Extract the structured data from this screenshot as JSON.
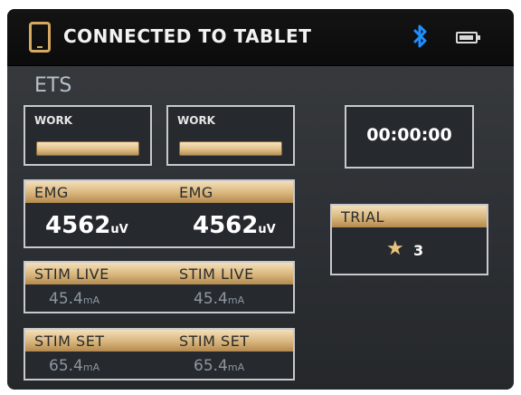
{
  "status_bar": {
    "connection_text": "CONNECTED TO TABLET",
    "icons": [
      "tablet-icon",
      "bluetooth-icon",
      "battery-icon"
    ]
  },
  "mode_title": "ETS",
  "work": [
    {
      "label": "WORK"
    },
    {
      "label": "WORK"
    }
  ],
  "timer": {
    "value": "00:00:00"
  },
  "emg": [
    {
      "label": "EMG",
      "value": "4562",
      "unit": "uV"
    },
    {
      "label": "EMG",
      "value": "4562",
      "unit": "uV"
    }
  ],
  "stim_live": [
    {
      "label": "STIM LIVE",
      "value": "45.4",
      "unit": "mA"
    },
    {
      "label": "STIM LIVE",
      "value": "45.4",
      "unit": "mA"
    }
  ],
  "stim_set": [
    {
      "label": "STIM SET",
      "value": "65.4",
      "unit": "mA"
    },
    {
      "label": "STIM SET",
      "value": "65.4",
      "unit": "mA"
    }
  ],
  "trial": {
    "label": "TRIAL",
    "value": "3"
  },
  "colors": {
    "accent": "#d8b57c",
    "background": "#2f3236",
    "topbar": "#0e0e0e",
    "bluetooth": "#1f8fff"
  }
}
